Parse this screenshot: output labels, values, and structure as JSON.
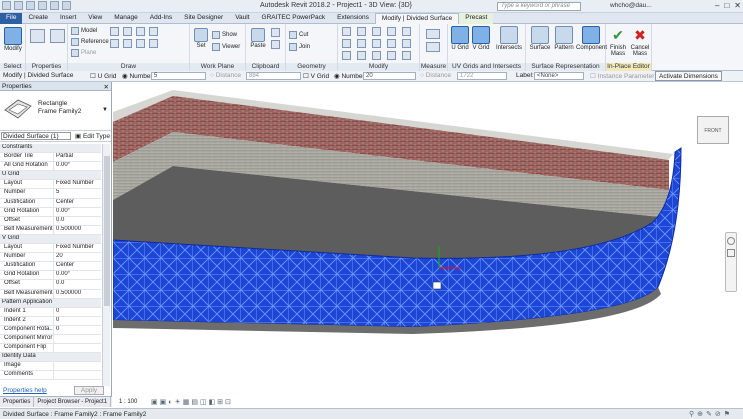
{
  "app": {
    "title": "Autodesk Revit 2018.2 -",
    "doc_title": "Project1 - 3D View: {3D}",
    "search_placeholder": "Type a keyword or phrase",
    "user": "whcho@dau..."
  },
  "tabs": [
    "File",
    "Create",
    "Insert",
    "View",
    "Manage",
    "Add-Ins",
    "Site Designer",
    "Vault",
    "GRAITEC PowerPack",
    "Extensions",
    "Modify | Divided Surface",
    "Precast"
  ],
  "ribbon": {
    "panels": {
      "select": "Select",
      "properties": "Properties",
      "draw": "Draw",
      "work_plane": "Work Plane",
      "clipboard": "Clipboard",
      "geometry": "Geometry",
      "modify": "Modify",
      "measure": "Measure",
      "uv_grids": "UV Grids and Intersects",
      "surface_rep": "Surface Representation",
      "in_place": "In-Place Editor"
    },
    "buttons": {
      "modify": "Modify",
      "model": "Model",
      "reference": "Reference",
      "plane": "Plane",
      "set": "Set",
      "show": "Show",
      "viewer": "Viewer",
      "paste": "Paste",
      "cut": "Cut",
      "join": "Join",
      "u_grid": "U Grid",
      "v_grid": "V Grid",
      "intersects": "Intersects",
      "surface": "Surface",
      "pattern": "Pattern",
      "component": "Component",
      "finish_mass": "Finish Mass",
      "cancel_mass": "Cancel Mass"
    }
  },
  "options_bar": {
    "context": "Modify | Divided Surface",
    "u_grid_label": "U Grid",
    "number_label": "Number",
    "u_number": "5",
    "distance_label": "Distance",
    "u_distance": "884",
    "v_grid_label": "V Grid",
    "v_number_label": "Number",
    "v_number": "20",
    "v_distance_label": "Distance",
    "v_distance": "1722",
    "label_label": "Label:",
    "label_value": "<None>",
    "instance_param": "Instance Parameter",
    "activate_dimensions": "Activate Dimensions"
  },
  "properties": {
    "header": "Properties",
    "type_name_1": "Rectangle",
    "type_name_2": "Frame Family2",
    "instance_selector": "Divided Surface (1)",
    "edit_type": "Edit Type",
    "rows": [
      {
        "group": "Constraints"
      },
      {
        "name": "Border Tile",
        "value": "Partial"
      },
      {
        "name": "All Grid Rotation",
        "value": "0.00°"
      },
      {
        "group": "U Grid"
      },
      {
        "name": "Layout",
        "value": "Fixed Number"
      },
      {
        "name": "Number",
        "value": "5"
      },
      {
        "name": "Justification",
        "value": "Center"
      },
      {
        "name": "Grid Rotation",
        "value": "0.00°"
      },
      {
        "name": "Offset",
        "value": "0.0"
      },
      {
        "name": "Belt Measurement",
        "value": "0.500000"
      },
      {
        "group": "V Grid"
      },
      {
        "name": "Layout",
        "value": "Fixed Number"
      },
      {
        "name": "Number",
        "value": "20"
      },
      {
        "name": "Justification",
        "value": "Center"
      },
      {
        "name": "Grid Rotation",
        "value": "0.00°"
      },
      {
        "name": "Offset",
        "value": "0.0"
      },
      {
        "name": "Belt Measurement",
        "value": "0.500000"
      },
      {
        "group": "Pattern Application"
      },
      {
        "name": "Indent 1",
        "value": "0"
      },
      {
        "name": "Indent 2",
        "value": "0"
      },
      {
        "name": "Component Rota...",
        "value": "0"
      },
      {
        "name": "Component Mirror",
        "value": ""
      },
      {
        "name": "Component Flip",
        "value": ""
      },
      {
        "group": "Identity Data"
      },
      {
        "name": "Image",
        "value": ""
      },
      {
        "name": "Comments",
        "value": ""
      }
    ],
    "help_link": "Properties help",
    "apply": "Apply"
  },
  "bottom_tabs": [
    "Properties",
    "Project Browser - Project1"
  ],
  "view_controls": {
    "scale": "1 : 100"
  },
  "viewcube_label": "FRONT",
  "status": "Divided Surface : Frame Family2 : Frame Family2",
  "colors": {
    "ribbon_bg": "#f4f6f9",
    "file_tab": "#2d5fa3",
    "mesh": "#1f4fd8",
    "brick": "#8a3f3a"
  }
}
